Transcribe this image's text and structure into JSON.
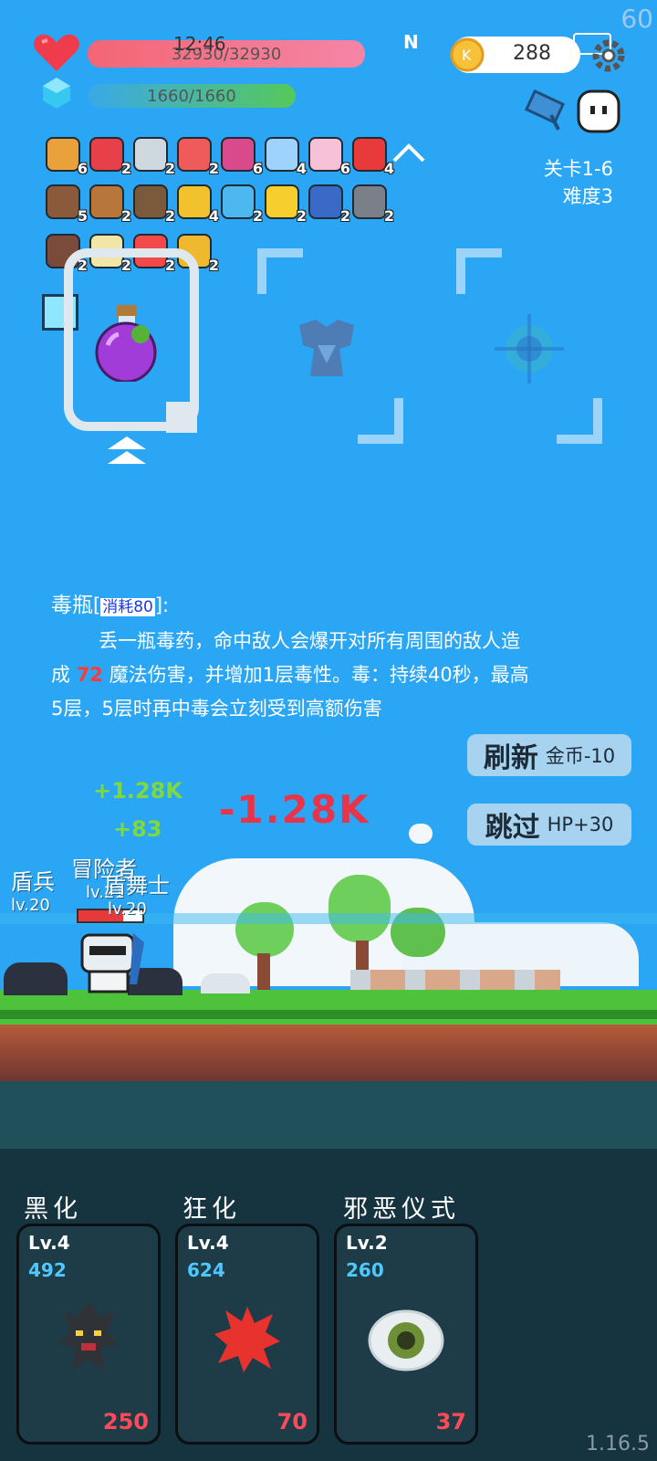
{
  "fps": "60",
  "version": "1.16.5",
  "status_bar": {
    "time": "12:46"
  },
  "hp": {
    "text": "32930/32930",
    "fraction": 1.0
  },
  "mp": {
    "text": "1660/1660",
    "fraction": 1.0
  },
  "coins": "288",
  "items": [
    {
      "icon": "book-icon",
      "count": "6"
    },
    {
      "icon": "discount-tag-icon",
      "count": "2"
    },
    {
      "icon": "sword-icon",
      "count": "2"
    },
    {
      "icon": "watermelon-icon",
      "count": "2"
    },
    {
      "icon": "jam-jar-icon",
      "count": "6"
    },
    {
      "icon": "star-card-icon",
      "count": "4"
    },
    {
      "icon": "ice-cream-icon",
      "count": "6"
    },
    {
      "icon": "apple-icon",
      "count": "4"
    },
    {
      "icon": "shield-icon",
      "count": "5"
    },
    {
      "icon": "drumstick-icon",
      "count": "2"
    },
    {
      "icon": "coconut-icon",
      "count": "2"
    },
    {
      "icon": "crown-icon",
      "count": "4"
    },
    {
      "icon": "speech-bubble-icon",
      "count": "2"
    },
    {
      "icon": "sun-orb-icon",
      "count": "2"
    },
    {
      "icon": "tarot-card-icon",
      "count": "2"
    },
    {
      "icon": "helmet-icon",
      "count": "2"
    },
    {
      "icon": "mushroom-icon",
      "count": "2"
    },
    {
      "icon": "lightbulb-icon",
      "count": "2"
    },
    {
      "icon": "pill-icon",
      "count": "2"
    },
    {
      "icon": "coin-stack-icon",
      "count": "2"
    }
  ],
  "stage": {
    "level": "关卡1-6",
    "difficulty": "难度3"
  },
  "skill_desc": {
    "name": "毒瓶",
    "cost": "消耗80",
    "colon": ":",
    "line1": "丢一瓶毒药，命中敌人会爆开对所有周围的敌人造",
    "p2a": "成 ",
    "damage": "72",
    "p2b": " 魔法伤害，并增加1层毒性。毒：持续40秒，最高",
    "line3": "5层，5层时再中毒会立刻受到高额伤害"
  },
  "buttons": {
    "refresh": {
      "label": "刷新",
      "sub": "金币-10"
    },
    "skip": {
      "label": "跳过",
      "sub": "HP+30"
    }
  },
  "battle": {
    "damage_text": "-1.28K",
    "heal_text": "+1.28K",
    "heal_extra": "+83",
    "units": [
      {
        "name": "盾兵",
        "level": "lv.20"
      },
      {
        "name": "冒险者",
        "level": "lv.21"
      },
      {
        "name": "盾舞士",
        "level": "lv.20"
      }
    ]
  },
  "skills": [
    {
      "title": "黑化",
      "level": "Lv.4",
      "value": "492",
      "price": "250",
      "icon": "dark-tree-icon"
    },
    {
      "title": "狂化",
      "level": "Lv.4",
      "value": "624",
      "price": "70",
      "icon": "red-splat-icon"
    },
    {
      "title": "邪恶仪式",
      "level": "Lv.2",
      "value": "260",
      "price": "37",
      "icon": "eye-icon"
    }
  ],
  "colors": {
    "hp": "#f36675",
    "mp": "#3aa8e8",
    "sky": "#2ba6f5",
    "panel": "#163340",
    "price": "#ff4a5a"
  }
}
